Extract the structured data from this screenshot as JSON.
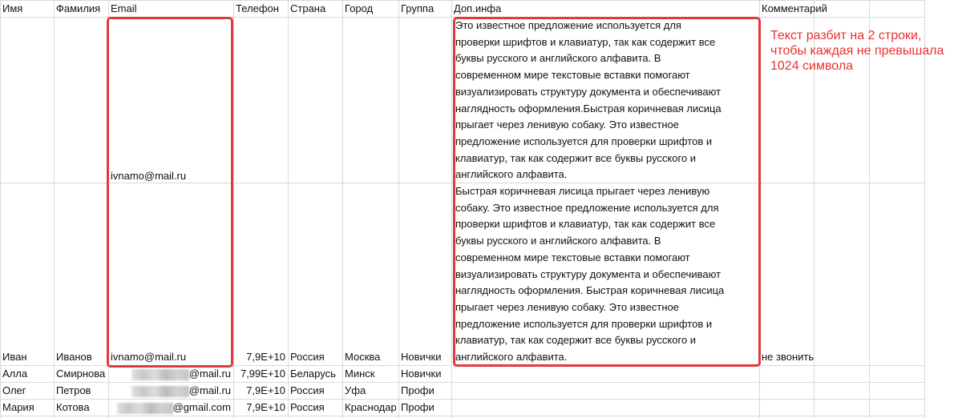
{
  "headers": [
    "Имя",
    "Фамилия",
    "Email",
    "Телефон",
    "Страна",
    "Город",
    "Группа",
    "Доп.инфа",
    "Комментарий"
  ],
  "rows": [
    {
      "email": "ivnamo@mail.ru"
    },
    {
      "name": "Иван",
      "surname": "Иванов",
      "email": "ivnamo@mail.ru",
      "phone": "7,9E+10",
      "country": "Россия",
      "city": "Москва",
      "group": "Новички",
      "comment": "не звонить"
    },
    {
      "name": "Алла",
      "surname": "Смирнова",
      "email": "@mail.ru",
      "phone": "7,99E+10",
      "country": "Беларусь",
      "city": "Минск",
      "group": "Новички"
    },
    {
      "name": "Олег",
      "surname": "Петров",
      "email": "@mail.ru",
      "phone": "7,9E+10",
      "country": "Россия",
      "city": "Уфа",
      "group": "Профи"
    },
    {
      "name": "Мария",
      "surname": "Котова",
      "email": "@gmail.com",
      "phone": "7,9E+10",
      "country": "Россия",
      "city": "Краснодар",
      "group": "Профи"
    }
  ],
  "info1": [
    "Это известное предложение используется для",
    "проверки шрифтов и клавиатур, так как содержит все",
    "буквы русского и английского алфавита. В",
    "современном мире текстовые вставки помогают",
    "визуализировать структуру документа и обеспечивают",
    "наглядность оформления.Быстрая коричневая лисица",
    "прыгает через ленивую собаку. Это известное",
    "предложение используется для проверки шрифтов и",
    "клавиатур, так как содержит все буквы русского и",
    "английского алфавита."
  ],
  "info2": [
    "Быстрая коричневая лисица прыгает через ленивую",
    "собаку. Это известное предложение используется для",
    "проверки шрифтов и клавиатур, так как содержит все",
    "буквы русского и английского алфавита. В",
    "современном мире текстовые вставки помогают",
    "визуализировать структуру документа и обеспечивают",
    "наглядность оформления. Быстрая коричневая лисица",
    "прыгает через ленивую собаку. Это известное",
    "предложение используется для проверки шрифтов и",
    "клавиатур, так как содержит все буквы русского и",
    "английского алфавита."
  ],
  "annotation": [
    "Текст разбит на 2 строки,",
    "чтобы каждая не превышала",
    "1024 символа"
  ],
  "colors": {
    "highlight": "#e03a3a",
    "note": "#e8322e",
    "grid": "#d9d9d9"
  }
}
